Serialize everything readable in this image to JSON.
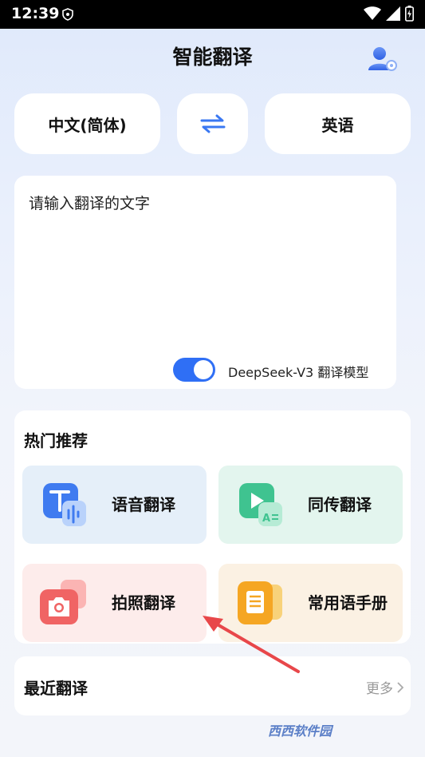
{
  "status_bar": {
    "time": "12:39"
  },
  "header": {
    "title": "智能翻译"
  },
  "languages": {
    "source": "中文(简体)",
    "target": "英语"
  },
  "input": {
    "placeholder": "请输入翻译的文字"
  },
  "model_toggle": {
    "label": "DeepSeek-V3 翻译模型",
    "enabled": true
  },
  "recommend": {
    "title": "热门推荐",
    "items": [
      {
        "label": "语音翻译",
        "icon": "text-voice-icon"
      },
      {
        "label": "同传翻译",
        "icon": "video-translate-icon"
      },
      {
        "label": "拍照翻译",
        "icon": "camera-icon"
      },
      {
        "label": "常用语手册",
        "icon": "phrasebook-icon"
      }
    ]
  },
  "recent": {
    "title": "最近翻译",
    "more": "更多"
  },
  "watermark": "西西软件园",
  "colors": {
    "accent": "#2f6ff5",
    "annotation_arrow": "#e8474a"
  }
}
